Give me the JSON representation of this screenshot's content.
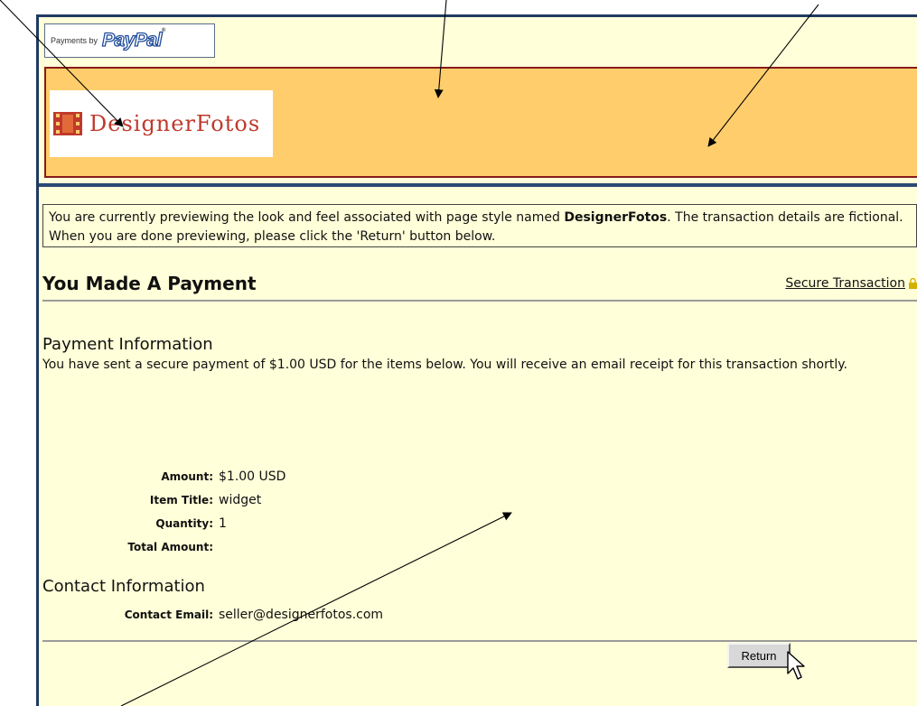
{
  "paypal_badge": {
    "label": "Payments by",
    "logo_text": "PayPal",
    "trademark": "®"
  },
  "brand": {
    "name": "DesignerFotos",
    "icon": "film-strip-icon",
    "color": "#c0392b"
  },
  "notice": {
    "text_1": "You are currently previewing the look and feel associated with page style named ",
    "style_name": "DesignerFotos",
    "text_2": ". The transaction details are fictional. When you are done previewing, please click the 'Return' button below."
  },
  "heading": {
    "title": "You Made A Payment",
    "secure_link": "Secure Transaction",
    "lock_icon": "lock-icon"
  },
  "payment_info": {
    "title": "Payment Information",
    "text": "You have sent a secure payment of $1.00 USD for the items below. You will receive an email receipt for this transaction shortly."
  },
  "details": [
    {
      "label": "Amount:",
      "value": "$1.00 USD"
    },
    {
      "label": "Item Title:",
      "value": "widget"
    },
    {
      "label": "Quantity:",
      "value": "1"
    },
    {
      "label": "Total Amount:",
      "value": ""
    }
  ],
  "contact": {
    "title": "Contact Information",
    "label": "Contact Email:",
    "value": "seller@designerfotos.com"
  },
  "return_button": {
    "label": "Return"
  },
  "colors": {
    "page_background": "#ffffd9",
    "header_band": "#ffcd6b",
    "header_border": "#861a1a",
    "accent_blue": "#2c4a77"
  }
}
